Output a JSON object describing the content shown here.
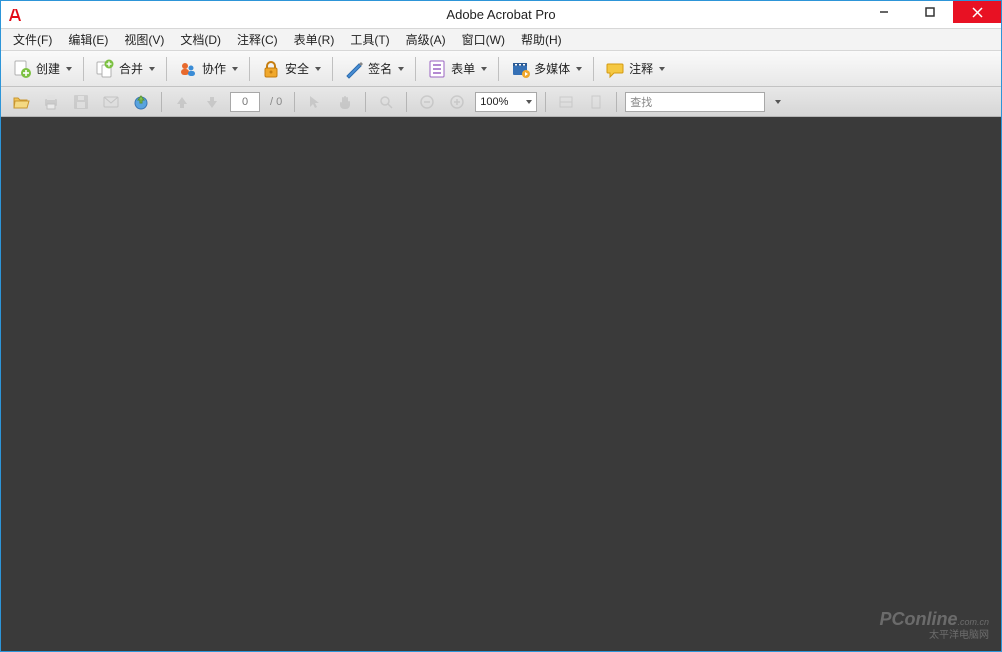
{
  "titlebar": {
    "title": "Adobe Acrobat Pro"
  },
  "menus": [
    "文件(F)",
    "编辑(E)",
    "视图(V)",
    "文档(D)",
    "注释(C)",
    "表单(R)",
    "工具(T)",
    "高级(A)",
    "窗口(W)",
    "帮助(H)"
  ],
  "toolbar": {
    "create": "创建",
    "merge": "合并",
    "collab": "协作",
    "secure": "安全",
    "sign": "签名",
    "forms": "表单",
    "multimedia": "多媒体",
    "comment": "注释"
  },
  "nav": {
    "page_current": "0",
    "page_total": "/ 0",
    "zoom": "100%"
  },
  "search": {
    "placeholder": "查找"
  },
  "watermark": {
    "main": "PConline",
    "sub": "太平洋电脑网",
    "suffix": ".com.cn"
  }
}
